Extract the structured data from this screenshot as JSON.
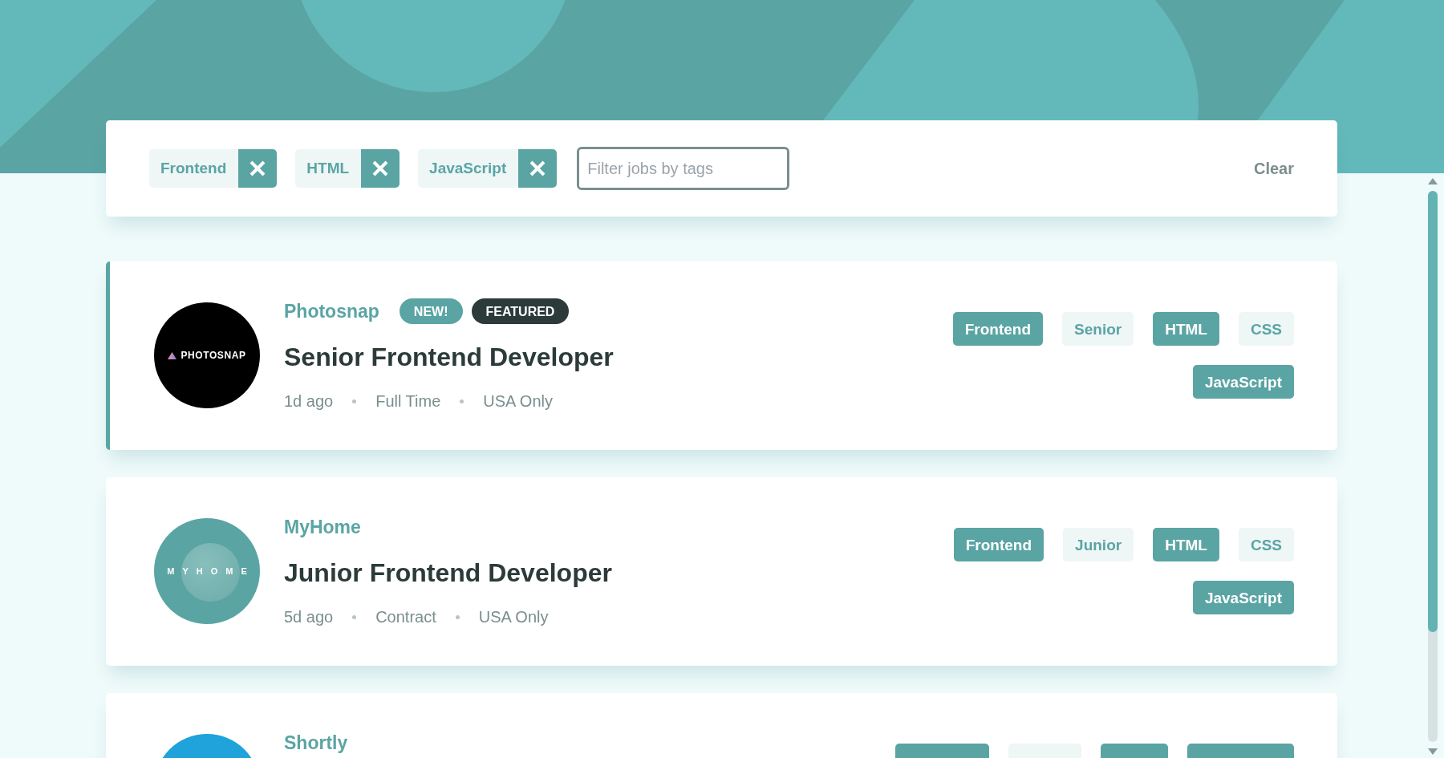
{
  "filter_bar": {
    "tags": [
      {
        "label": "Frontend"
      },
      {
        "label": "HTML"
      },
      {
        "label": "JavaScript"
      }
    ],
    "search": {
      "placeholder": "Filter jobs by tags"
    },
    "clear_label": "Clear"
  },
  "jobs": [
    {
      "featured": true,
      "logo": {
        "kind": "photosnap",
        "text": "PHOTOSNAP"
      },
      "company": "Photosnap",
      "badges": [
        {
          "kind": "new",
          "label": "NEW!"
        },
        {
          "kind": "featured",
          "label": "FEATURED"
        }
      ],
      "title": "Senior Frontend Developer",
      "meta": {
        "posted": "1d ago",
        "contract": "Full Time",
        "location": "USA Only"
      },
      "tags": [
        {
          "label": "Frontend",
          "selected": true
        },
        {
          "label": "Senior",
          "selected": false
        },
        {
          "label": "HTML",
          "selected": true
        },
        {
          "label": "CSS",
          "selected": false
        },
        {
          "label": "JavaScript",
          "selected": true
        }
      ]
    },
    {
      "featured": false,
      "logo": {
        "kind": "myhome",
        "text": "MYHOME"
      },
      "company": "MyHome",
      "title": "Junior Frontend Developer",
      "meta": {
        "posted": "5d ago",
        "contract": "Contract",
        "location": "USA Only"
      },
      "tags": [
        {
          "label": "Frontend",
          "selected": true
        },
        {
          "label": "Junior",
          "selected": false
        },
        {
          "label": "HTML",
          "selected": true
        },
        {
          "label": "CSS",
          "selected": false
        },
        {
          "label": "JavaScript",
          "selected": true
        }
      ]
    },
    {
      "featured": false,
      "logo": {
        "kind": "shortly"
      },
      "company": "Shortly",
      "tags": [
        {
          "selected": true
        },
        {
          "selected": false
        },
        {
          "selected": true
        },
        {
          "selected": true
        }
      ]
    }
  ]
}
